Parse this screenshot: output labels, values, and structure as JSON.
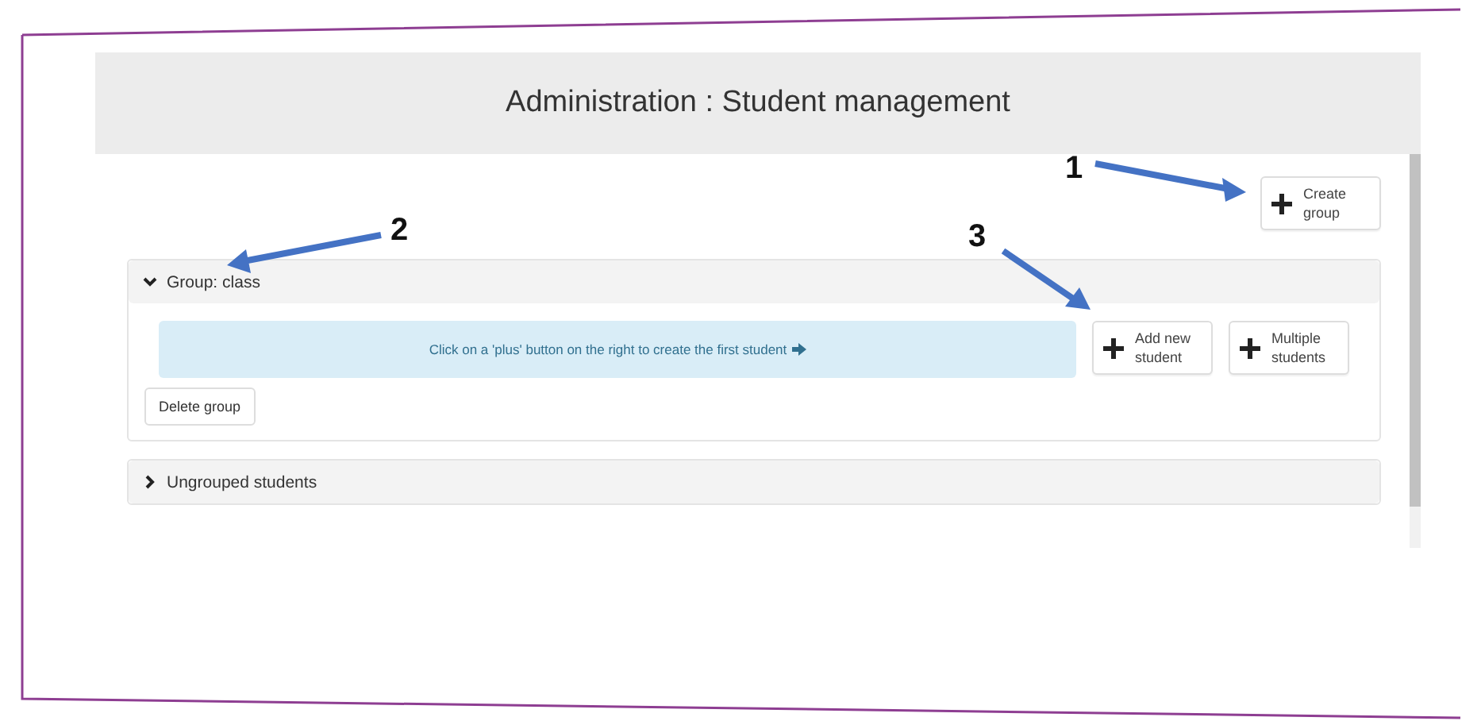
{
  "window": {
    "title": "Administration : Student management"
  },
  "create_button": {
    "label": "Create group"
  },
  "groups": [
    {
      "title": "Group: class",
      "expanded": true,
      "hint": "Click on a 'plus' button on the right to create the first student",
      "actions": [
        {
          "label": "Add new student"
        },
        {
          "label": "Multiple students"
        }
      ],
      "delete_label": "Delete group"
    },
    {
      "title": "Ungrouped students",
      "expanded": false
    }
  ],
  "annotations": [
    {
      "label": "1"
    },
    {
      "label": "2"
    },
    {
      "label": "3"
    }
  ]
}
